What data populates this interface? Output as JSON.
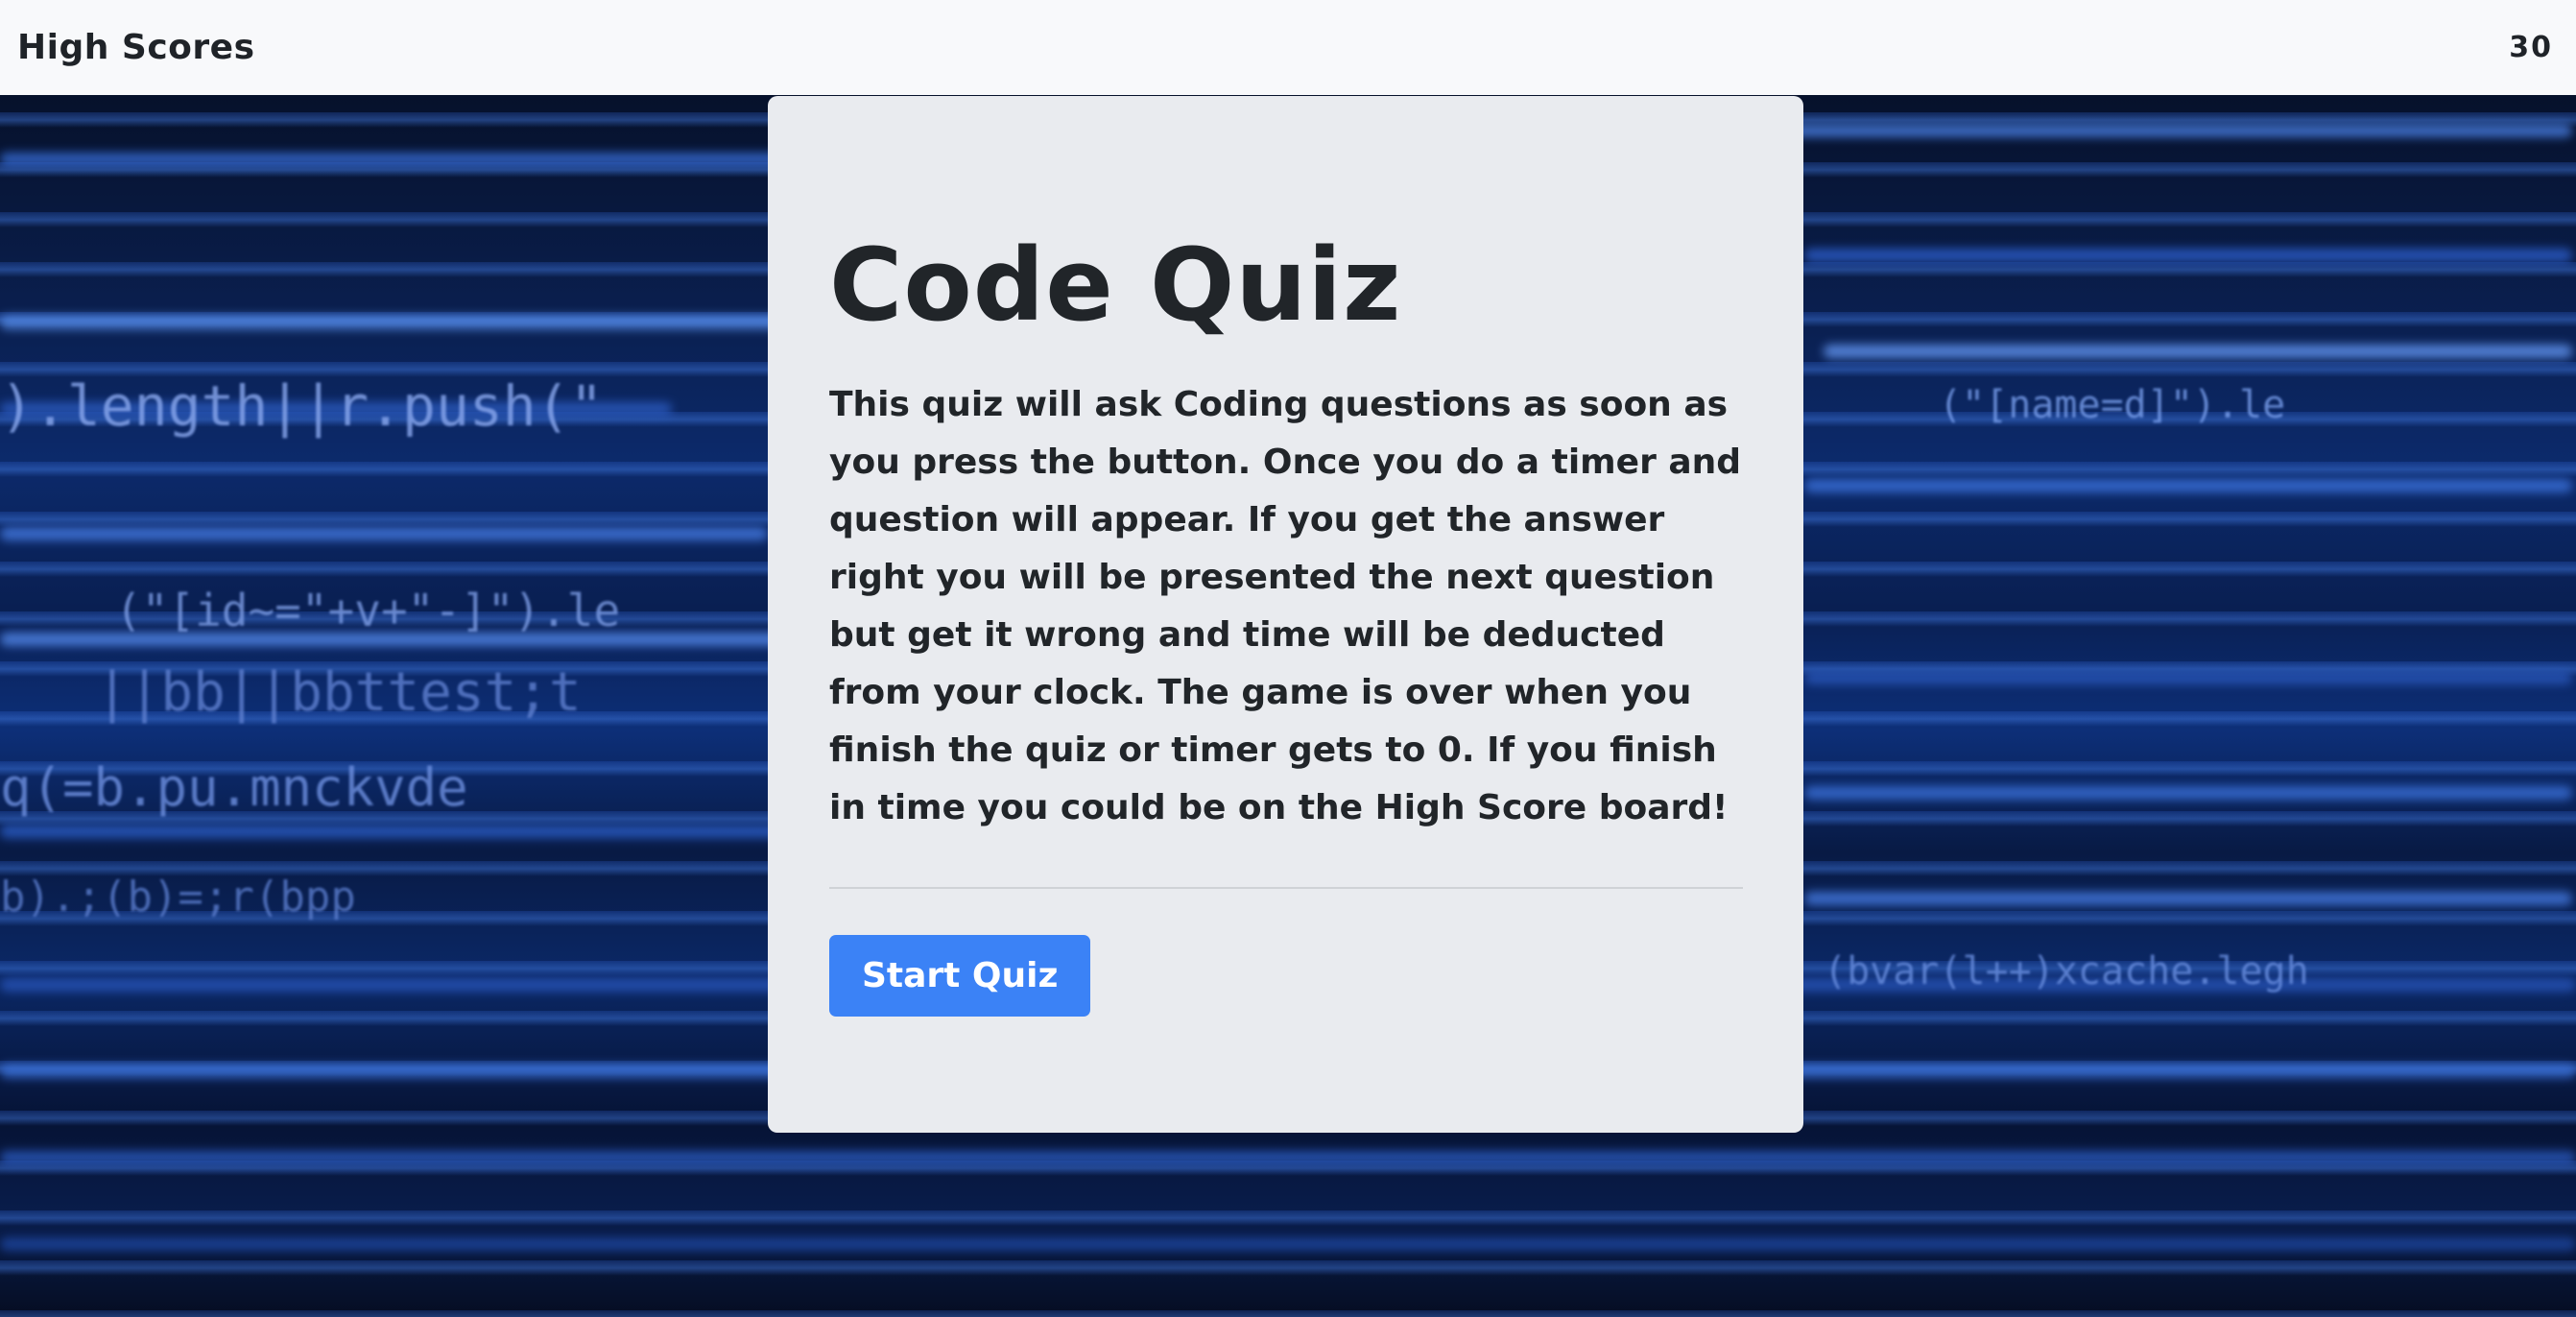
{
  "nav": {
    "high_scores_label": "High Scores",
    "timer_value": "30"
  },
  "card": {
    "title": "Code Quiz",
    "description": "This quiz will ask Coding questions as soon as you press the button. Once you do a timer and question will appear. If you get the answer right you will be presented the next question but get it wrong and time will be deducted from your clock. The game is over when you finish the quiz or timer gets to 0. If you finish in time you could be on the High Score board!",
    "start_button_label": "Start Quiz"
  },
  "colors": {
    "accent": "#3b82f6",
    "card_background": "#e9ebef",
    "navbar_background": "#f8f9fb"
  }
}
